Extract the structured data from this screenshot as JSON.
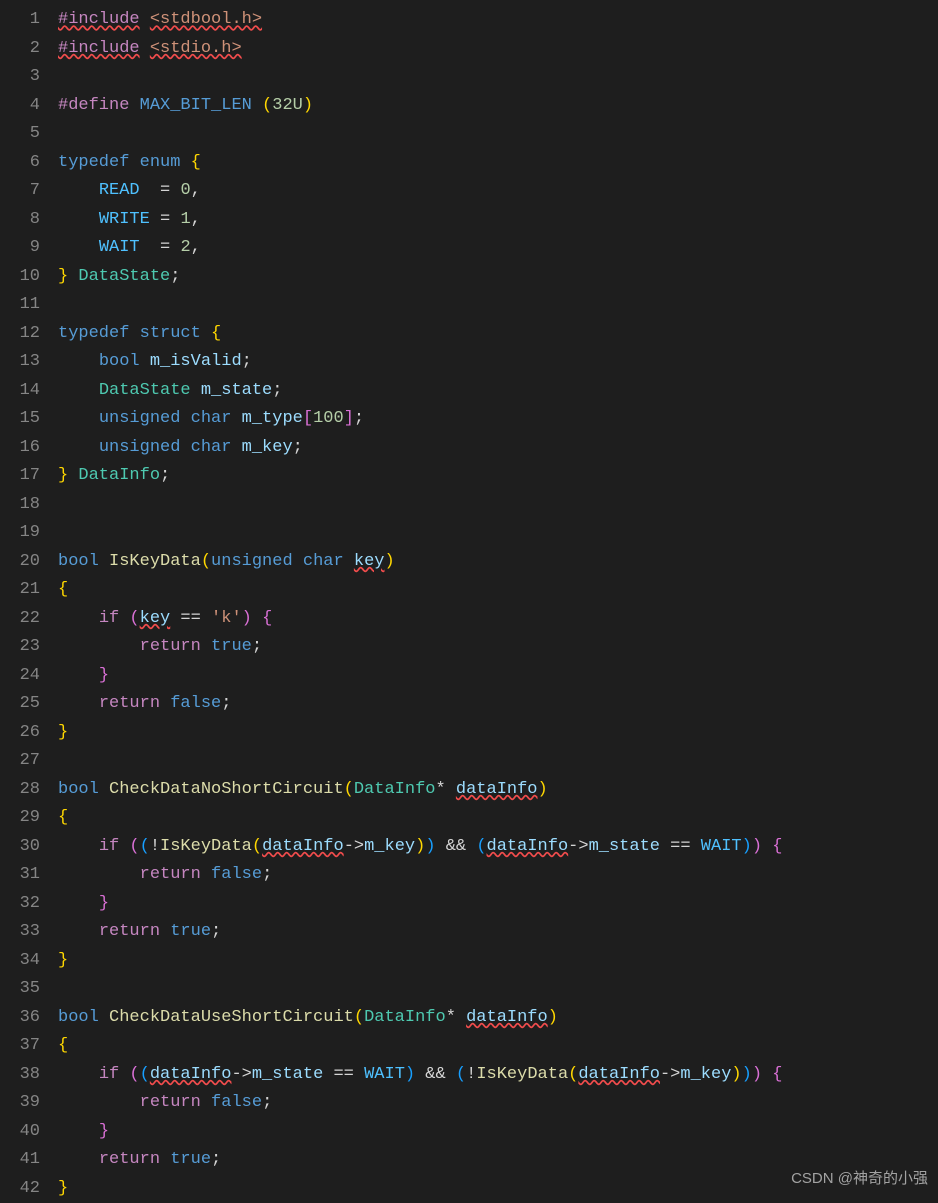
{
  "editor": {
    "line_count": 42,
    "watermark": "CSDN @神奇的小强",
    "lines": {
      "1": [
        {
          "t": "#include",
          "c": "c-control squiggle"
        },
        {
          "t": " ",
          "c": ""
        },
        {
          "t": "<stdbool.h>",
          "c": "c-angle squiggle"
        }
      ],
      "2": [
        {
          "t": "#include",
          "c": "c-control squiggle"
        },
        {
          "t": " ",
          "c": ""
        },
        {
          "t": "<stdio.h>",
          "c": "c-angle squiggle"
        }
      ],
      "3": [],
      "4": [
        {
          "t": "#define",
          "c": "c-control"
        },
        {
          "t": " ",
          "c": ""
        },
        {
          "t": "MAX_BIT_LEN",
          "c": "c-define"
        },
        {
          "t": " ",
          "c": ""
        },
        {
          "t": "(",
          "c": "c-brace"
        },
        {
          "t": "32U",
          "c": "c-num"
        },
        {
          "t": ")",
          "c": "c-brace"
        }
      ],
      "5": [],
      "6": [
        {
          "t": "typedef",
          "c": "c-keyword"
        },
        {
          "t": " ",
          "c": ""
        },
        {
          "t": "enum",
          "c": "c-keyword"
        },
        {
          "t": " ",
          "c": ""
        },
        {
          "t": "{",
          "c": "c-brace"
        }
      ],
      "7": [
        {
          "t": "    ",
          "c": ""
        },
        {
          "t": "READ",
          "c": "c-enum"
        },
        {
          "t": "  = ",
          "c": ""
        },
        {
          "t": "0",
          "c": "c-num"
        },
        {
          "t": ",",
          "c": ""
        }
      ],
      "8": [
        {
          "t": "    ",
          "c": ""
        },
        {
          "t": "WRITE",
          "c": "c-enum"
        },
        {
          "t": " = ",
          "c": ""
        },
        {
          "t": "1",
          "c": "c-num"
        },
        {
          "t": ",",
          "c": ""
        }
      ],
      "9": [
        {
          "t": "    ",
          "c": ""
        },
        {
          "t": "WAIT",
          "c": "c-enum"
        },
        {
          "t": "  = ",
          "c": ""
        },
        {
          "t": "2",
          "c": "c-num"
        },
        {
          "t": ",",
          "c": ""
        }
      ],
      "10": [
        {
          "t": "}",
          "c": "c-brace"
        },
        {
          "t": " ",
          "c": ""
        },
        {
          "t": "DataState",
          "c": "c-type"
        },
        {
          "t": ";",
          "c": ""
        }
      ],
      "11": [],
      "12": [
        {
          "t": "typedef",
          "c": "c-keyword"
        },
        {
          "t": " ",
          "c": ""
        },
        {
          "t": "struct",
          "c": "c-keyword"
        },
        {
          "t": " ",
          "c": ""
        },
        {
          "t": "{",
          "c": "c-brace"
        }
      ],
      "13": [
        {
          "t": "    ",
          "c": ""
        },
        {
          "t": "bool",
          "c": "c-keyword"
        },
        {
          "t": " ",
          "c": ""
        },
        {
          "t": "m_isValid",
          "c": "c-var"
        },
        {
          "t": ";",
          "c": ""
        }
      ],
      "14": [
        {
          "t": "    ",
          "c": ""
        },
        {
          "t": "DataState",
          "c": "c-type"
        },
        {
          "t": " ",
          "c": ""
        },
        {
          "t": "m_state",
          "c": "c-var"
        },
        {
          "t": ";",
          "c": ""
        }
      ],
      "15": [
        {
          "t": "    ",
          "c": ""
        },
        {
          "t": "unsigned",
          "c": "c-keyword"
        },
        {
          "t": " ",
          "c": ""
        },
        {
          "t": "char",
          "c": "c-keyword"
        },
        {
          "t": " ",
          "c": ""
        },
        {
          "t": "m_type",
          "c": "c-var"
        },
        {
          "t": "[",
          "c": "c-brace2"
        },
        {
          "t": "100",
          "c": "c-num"
        },
        {
          "t": "]",
          "c": "c-brace2"
        },
        {
          "t": ";",
          "c": ""
        }
      ],
      "16": [
        {
          "t": "    ",
          "c": ""
        },
        {
          "t": "unsigned",
          "c": "c-keyword"
        },
        {
          "t": " ",
          "c": ""
        },
        {
          "t": "char",
          "c": "c-keyword"
        },
        {
          "t": " ",
          "c": ""
        },
        {
          "t": "m_key",
          "c": "c-var"
        },
        {
          "t": ";",
          "c": ""
        }
      ],
      "17": [
        {
          "t": "}",
          "c": "c-brace"
        },
        {
          "t": " ",
          "c": ""
        },
        {
          "t": "DataInfo",
          "c": "c-type"
        },
        {
          "t": ";",
          "c": ""
        }
      ],
      "18": [],
      "19": [],
      "20": [
        {
          "t": "bool",
          "c": "c-keyword"
        },
        {
          "t": " ",
          "c": ""
        },
        {
          "t": "IsKeyData",
          "c": "c-func"
        },
        {
          "t": "(",
          "c": "c-brace"
        },
        {
          "t": "unsigned",
          "c": "c-keyword"
        },
        {
          "t": " ",
          "c": ""
        },
        {
          "t": "char",
          "c": "c-keyword"
        },
        {
          "t": " ",
          "c": ""
        },
        {
          "t": "key",
          "c": "c-var squiggle"
        },
        {
          "t": ")",
          "c": "c-brace"
        }
      ],
      "21": [
        {
          "t": "{",
          "c": "c-brace"
        }
      ],
      "22": [
        {
          "t": "    ",
          "c": ""
        },
        {
          "t": "if",
          "c": "c-control"
        },
        {
          "t": " ",
          "c": ""
        },
        {
          "t": "(",
          "c": "c-brace2"
        },
        {
          "t": "key",
          "c": "c-var squiggle"
        },
        {
          "t": " == ",
          "c": ""
        },
        {
          "t": "'k'",
          "c": "c-str"
        },
        {
          "t": ")",
          "c": "c-brace2"
        },
        {
          "t": " ",
          "c": ""
        },
        {
          "t": "{",
          "c": "c-brace2"
        }
      ],
      "23": [
        {
          "t": "        ",
          "c": ""
        },
        {
          "t": "return",
          "c": "c-control"
        },
        {
          "t": " ",
          "c": ""
        },
        {
          "t": "true",
          "c": "c-keyword"
        },
        {
          "t": ";",
          "c": ""
        }
      ],
      "24": [
        {
          "t": "    ",
          "c": ""
        },
        {
          "t": "}",
          "c": "c-brace2"
        }
      ],
      "25": [
        {
          "t": "    ",
          "c": ""
        },
        {
          "t": "return",
          "c": "c-control"
        },
        {
          "t": " ",
          "c": ""
        },
        {
          "t": "false",
          "c": "c-keyword"
        },
        {
          "t": ";",
          "c": ""
        }
      ],
      "26": [
        {
          "t": "}",
          "c": "c-brace"
        }
      ],
      "27": [],
      "28": [
        {
          "t": "bool",
          "c": "c-keyword"
        },
        {
          "t": " ",
          "c": ""
        },
        {
          "t": "CheckDataNoShortCircuit",
          "c": "c-func"
        },
        {
          "t": "(",
          "c": "c-brace"
        },
        {
          "t": "DataInfo",
          "c": "c-type"
        },
        {
          "t": "*",
          "c": ""
        },
        {
          "t": " ",
          "c": ""
        },
        {
          "t": "dataInfo",
          "c": "c-var squiggle"
        },
        {
          "t": ")",
          "c": "c-brace"
        }
      ],
      "29": [
        {
          "t": "{",
          "c": "c-brace"
        }
      ],
      "30": [
        {
          "t": "    ",
          "c": ""
        },
        {
          "t": "if",
          "c": "c-control"
        },
        {
          "t": " ",
          "c": ""
        },
        {
          "t": "(",
          "c": "c-brace2"
        },
        {
          "t": "(",
          "c": "c-brace3"
        },
        {
          "t": "!",
          "c": ""
        },
        {
          "t": "IsKeyData",
          "c": "c-func"
        },
        {
          "t": "(",
          "c": "c-brace"
        },
        {
          "t": "dataInfo",
          "c": "c-var squiggle"
        },
        {
          "t": "->",
          "c": ""
        },
        {
          "t": "m_key",
          "c": "c-var"
        },
        {
          "t": ")",
          "c": "c-brace"
        },
        {
          "t": ")",
          "c": "c-brace3"
        },
        {
          "t": " && ",
          "c": ""
        },
        {
          "t": "(",
          "c": "c-brace3"
        },
        {
          "t": "dataInfo",
          "c": "c-var squiggle"
        },
        {
          "t": "->",
          "c": ""
        },
        {
          "t": "m_state",
          "c": "c-var"
        },
        {
          "t": " == ",
          "c": ""
        },
        {
          "t": "WAIT",
          "c": "c-enum"
        },
        {
          "t": ")",
          "c": "c-brace3"
        },
        {
          "t": ")",
          "c": "c-brace2"
        },
        {
          "t": " ",
          "c": ""
        },
        {
          "t": "{",
          "c": "c-brace2"
        }
      ],
      "31": [
        {
          "t": "        ",
          "c": ""
        },
        {
          "t": "return",
          "c": "c-control"
        },
        {
          "t": " ",
          "c": ""
        },
        {
          "t": "false",
          "c": "c-keyword"
        },
        {
          "t": ";",
          "c": ""
        }
      ],
      "32": [
        {
          "t": "    ",
          "c": ""
        },
        {
          "t": "}",
          "c": "c-brace2"
        }
      ],
      "33": [
        {
          "t": "    ",
          "c": ""
        },
        {
          "t": "return",
          "c": "c-control"
        },
        {
          "t": " ",
          "c": ""
        },
        {
          "t": "true",
          "c": "c-keyword"
        },
        {
          "t": ";",
          "c": ""
        }
      ],
      "34": [
        {
          "t": "}",
          "c": "c-brace"
        }
      ],
      "35": [],
      "36": [
        {
          "t": "bool",
          "c": "c-keyword"
        },
        {
          "t": " ",
          "c": ""
        },
        {
          "t": "CheckDataUseShortCircuit",
          "c": "c-func"
        },
        {
          "t": "(",
          "c": "c-brace"
        },
        {
          "t": "DataInfo",
          "c": "c-type"
        },
        {
          "t": "*",
          "c": ""
        },
        {
          "t": " ",
          "c": ""
        },
        {
          "t": "dataInfo",
          "c": "c-var squiggle"
        },
        {
          "t": ")",
          "c": "c-brace"
        }
      ],
      "37": [
        {
          "t": "{",
          "c": "c-brace"
        }
      ],
      "38": [
        {
          "t": "    ",
          "c": ""
        },
        {
          "t": "if",
          "c": "c-control"
        },
        {
          "t": " ",
          "c": ""
        },
        {
          "t": "(",
          "c": "c-brace2"
        },
        {
          "t": "(",
          "c": "c-brace3"
        },
        {
          "t": "dataInfo",
          "c": "c-var squiggle"
        },
        {
          "t": "->",
          "c": ""
        },
        {
          "t": "m_state",
          "c": "c-var"
        },
        {
          "t": " == ",
          "c": ""
        },
        {
          "t": "WAIT",
          "c": "c-enum"
        },
        {
          "t": ")",
          "c": "c-brace3"
        },
        {
          "t": " && ",
          "c": ""
        },
        {
          "t": "(",
          "c": "c-brace3"
        },
        {
          "t": "!",
          "c": ""
        },
        {
          "t": "IsKeyData",
          "c": "c-func"
        },
        {
          "t": "(",
          "c": "c-brace"
        },
        {
          "t": "dataInfo",
          "c": "c-var squiggle"
        },
        {
          "t": "->",
          "c": ""
        },
        {
          "t": "m_key",
          "c": "c-var"
        },
        {
          "t": ")",
          "c": "c-brace"
        },
        {
          "t": ")",
          "c": "c-brace3"
        },
        {
          "t": ")",
          "c": "c-brace2"
        },
        {
          "t": " ",
          "c": ""
        },
        {
          "t": "{",
          "c": "c-brace2"
        }
      ],
      "39": [
        {
          "t": "        ",
          "c": ""
        },
        {
          "t": "return",
          "c": "c-control"
        },
        {
          "t": " ",
          "c": ""
        },
        {
          "t": "false",
          "c": "c-keyword"
        },
        {
          "t": ";",
          "c": ""
        }
      ],
      "40": [
        {
          "t": "    ",
          "c": ""
        },
        {
          "t": "}",
          "c": "c-brace2"
        }
      ],
      "41": [
        {
          "t": "    ",
          "c": ""
        },
        {
          "t": "return",
          "c": "c-control"
        },
        {
          "t": " ",
          "c": ""
        },
        {
          "t": "true",
          "c": "c-keyword"
        },
        {
          "t": ";",
          "c": ""
        }
      ],
      "42": [
        {
          "t": "}",
          "c": "c-brace"
        }
      ]
    }
  }
}
